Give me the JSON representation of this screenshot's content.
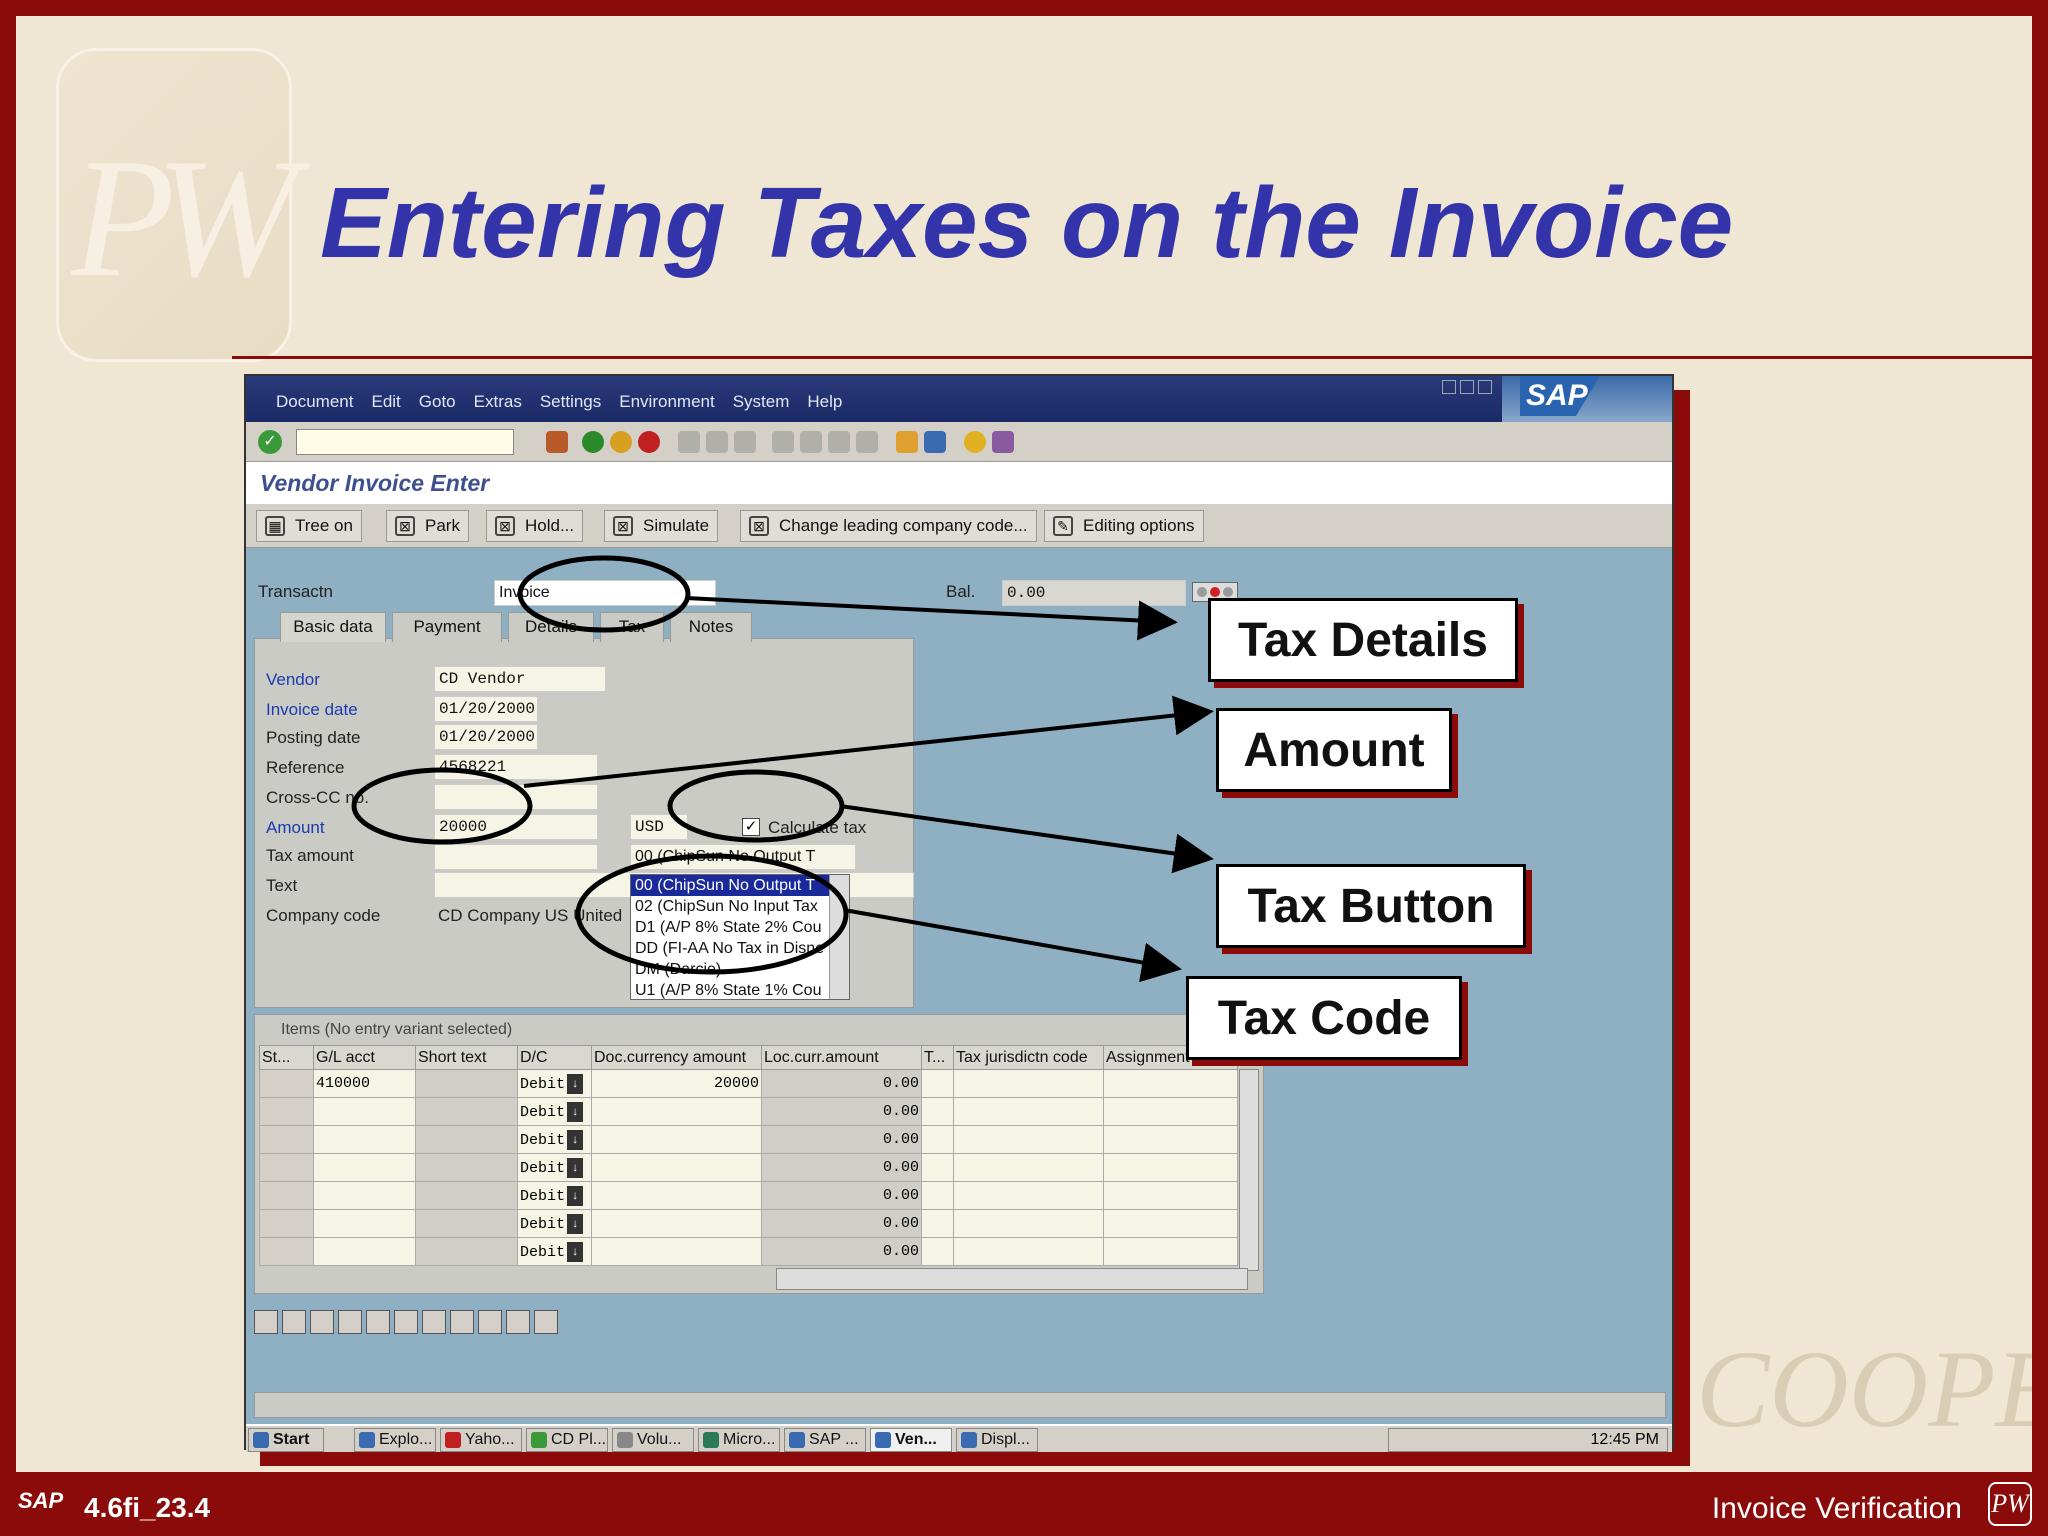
{
  "slide": {
    "title": "Entering Taxes on the Invoice",
    "watermark": "COOPERS",
    "logo_text": "PW",
    "footer_code": "4.6fi_23.4",
    "footer_sap": "SAP",
    "footer_right": "Invoice Verification"
  },
  "sap": {
    "menu": [
      "Document",
      "Edit",
      "Goto",
      "Extras",
      "Settings",
      "Environment",
      "System",
      "Help"
    ],
    "logo": "SAP",
    "screen_title": "Vendor Invoice Enter",
    "app_buttons": [
      "Tree on",
      "Park",
      "Hold...",
      "Simulate",
      "Change leading company code...",
      "Editing options"
    ],
    "transactn_label": "Transactn",
    "transactn_value": "Invoice",
    "bal_label": "Bal.",
    "bal_value": "0.00",
    "tabs": [
      "Basic data",
      "Payment",
      "Details",
      "Tax",
      "Notes"
    ],
    "fields": {
      "vendor_label": "Vendor",
      "vendor_value": "CD Vendor",
      "invoice_date_label": "Invoice date",
      "invoice_date_value": "01/20/2000",
      "posting_date_label": "Posting date",
      "posting_date_value": "01/20/2000",
      "reference_label": "Reference",
      "reference_value": "4568221",
      "crosscc_label": "Cross-CC no.",
      "amount_label": "Amount",
      "amount_value": "20000",
      "currency": "USD",
      "calc_tax_label": "Calculate tax",
      "tax_amount_label": "Tax amount",
      "tax_code_value": "00 (ChipSun No Output T",
      "text_label": "Text",
      "company_code_label": "Company code",
      "company_code_value": "CD Company US United"
    },
    "tax_codes": [
      "00 (ChipSun No Output T",
      "02 (ChipSun No Input Tax",
      "D1 (A/P 8% State 2% Cou",
      "DD (FI-AA No Tax in Disne",
      "DM (Darcie)",
      "U1 (A/P 8% State 1% Cou"
    ],
    "items_title": "Items (No entry variant selected)",
    "columns": [
      "St...",
      "G/L acct",
      "Short text",
      "D/C",
      "Doc.currency amount",
      "Loc.curr.amount",
      "T...",
      "Tax jurisdictn code",
      "Assignment"
    ],
    "rows": [
      {
        "gl": "410000",
        "dc": "Debit",
        "doc": "20000",
        "loc": "0.00"
      },
      {
        "gl": "",
        "dc": "Debit",
        "doc": "",
        "loc": "0.00"
      },
      {
        "gl": "",
        "dc": "Debit",
        "doc": "",
        "loc": "0.00"
      },
      {
        "gl": "",
        "dc": "Debit",
        "doc": "",
        "loc": "0.00"
      },
      {
        "gl": "",
        "dc": "Debit",
        "doc": "",
        "loc": "0.00"
      },
      {
        "gl": "",
        "dc": "Debit",
        "doc": "",
        "loc": "0.00"
      },
      {
        "gl": "",
        "dc": "Debit",
        "doc": "",
        "loc": "0.00"
      }
    ],
    "taskbar": [
      "Start",
      "Explo...",
      "Yaho...",
      "CD Pl...",
      "Volu...",
      "Micro...",
      "SAP ...",
      "Ven...",
      "Displ..."
    ],
    "clock": "12:45 PM"
  },
  "callouts": {
    "tax_details": "Tax Details",
    "amount": "Amount",
    "tax_button": "Tax Button",
    "tax_code": "Tax Code"
  },
  "colors": {
    "frame": "#8b0a0a",
    "title": "#3333aa",
    "sap_blue": "#1a2a66",
    "screen_bg": "#8fafc2"
  }
}
